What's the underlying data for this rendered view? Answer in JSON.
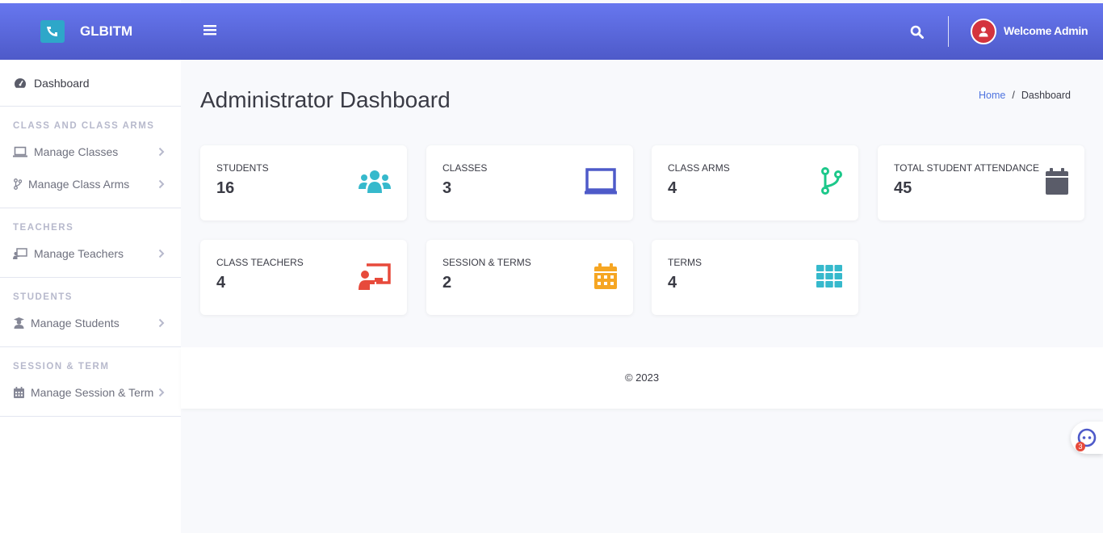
{
  "brand": {
    "name": "GLBITM"
  },
  "header": {
    "welcome": "Welcome Admin"
  },
  "sidebar": {
    "dashboard": "Dashboard",
    "sections": [
      {
        "heading": "CLASS AND CLASS ARMS",
        "items": [
          "Manage Classes",
          "Manage Class Arms"
        ]
      },
      {
        "heading": "TEACHERS",
        "items": [
          "Manage Teachers"
        ]
      },
      {
        "heading": "STUDENTS",
        "items": [
          "Manage Students"
        ]
      },
      {
        "heading": "SESSION & TERM",
        "items": [
          "Manage Session & Term"
        ]
      }
    ]
  },
  "main": {
    "title": "Administrator Dashboard",
    "breadcrumb": {
      "home": "Home",
      "separator": "/",
      "current": "Dashboard"
    },
    "cards": [
      {
        "label": "Students",
        "value": "16",
        "icon": "users-icon",
        "color": "#36b9cc"
      },
      {
        "label": "Classes",
        "value": "3",
        "icon": "laptop-icon",
        "color": "#4e73df"
      },
      {
        "label": "Class Arms",
        "value": "4",
        "icon": "code-branch-icon",
        "color": "#1cc88a"
      },
      {
        "label": "Total Student Attendance",
        "value": "45",
        "icon": "calendar-icon",
        "color": "#5a5c69"
      },
      {
        "label": "Class Teachers",
        "value": "4",
        "icon": "chalkboard-teacher-icon",
        "color": "#e74a3b"
      },
      {
        "label": "Session & Terms",
        "value": "2",
        "icon": "calendar-alt-icon",
        "color": "#f6a623"
      },
      {
        "label": "Terms",
        "value": "4",
        "icon": "th-icon",
        "color": "#36b9cc"
      }
    ]
  },
  "footer": {
    "copyright": "© 2023"
  },
  "chat": {
    "badge": "3"
  }
}
